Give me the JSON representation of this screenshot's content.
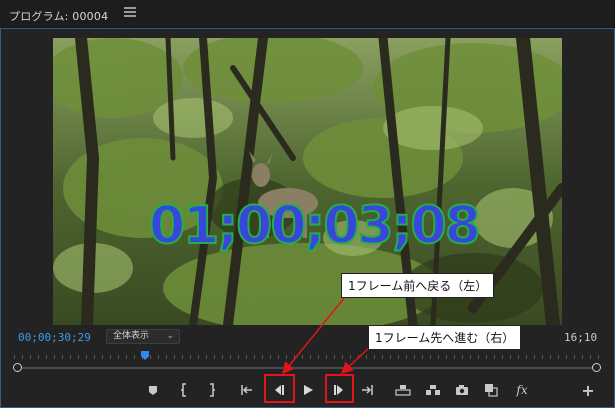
{
  "panel": {
    "title": "プログラム: 00004"
  },
  "video": {
    "overlay_timecode": "01;00;03;08"
  },
  "status": {
    "current_time": "00;00;30;29",
    "zoom_select": "全体表示",
    "duration": "16;10"
  },
  "controls": [
    {
      "name": "add-marker-button",
      "icon": "marker-icon"
    },
    {
      "name": "mark-in-button",
      "icon": "mark-in-icon"
    },
    {
      "name": "mark-out-button",
      "icon": "mark-out-icon"
    },
    {
      "name": "go-to-in-button",
      "icon": "go-to-in-icon"
    },
    {
      "name": "step-back-button",
      "icon": "step-back-icon"
    },
    {
      "name": "play-button",
      "icon": "play-icon"
    },
    {
      "name": "step-forward-button",
      "icon": "step-forward-icon"
    },
    {
      "name": "go-to-out-button",
      "icon": "go-to-out-icon"
    },
    {
      "name": "lift-button",
      "icon": "lift-icon"
    },
    {
      "name": "extract-button",
      "icon": "extract-icon"
    },
    {
      "name": "export-frame-button",
      "icon": "camera-icon"
    },
    {
      "name": "compare-view-button",
      "icon": "compare-icon"
    },
    {
      "name": "fx-button",
      "icon": "fx-icon"
    },
    {
      "name": "add-button",
      "icon": "plus-icon"
    }
  ],
  "annotations": {
    "step_back_label": "1フレーム前へ戻る（左）",
    "step_forward_label": "1フレーム先へ進む（右）",
    "highlight_color": "#e0141a"
  },
  "colors": {
    "timecode_blue": "#3f9be8",
    "playhead_blue": "#2d8ceb",
    "overlay_fill": "#3a45dc",
    "overlay_stroke": "#1fb04a"
  }
}
